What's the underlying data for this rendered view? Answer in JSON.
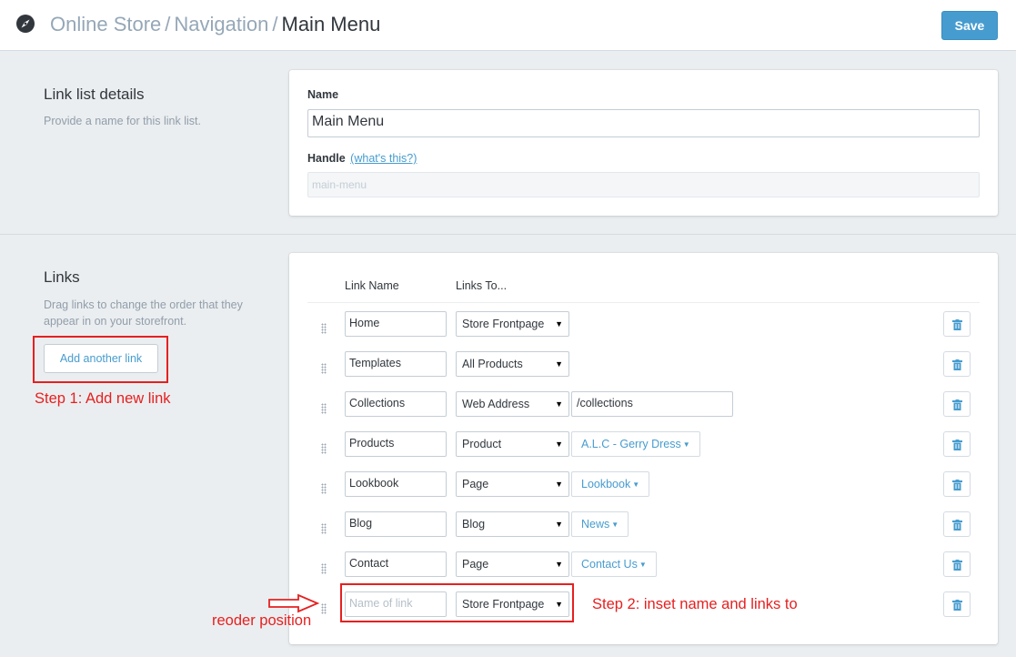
{
  "header": {
    "breadcrumb": [
      "Online Store",
      "Navigation"
    ],
    "current": "Main Menu",
    "separator": "/",
    "save_label": "Save"
  },
  "details": {
    "title": "Link list details",
    "description": "Provide a name for this link list.",
    "name_label": "Name",
    "name_value": "Main Menu",
    "handle_label": "Handle",
    "handle_help": "(what's this?)",
    "handle_value": "main-menu"
  },
  "links_section": {
    "title": "Links",
    "description": "Drag links to change the order that they appear in on your storefront.",
    "add_label": "Add another link",
    "col_name": "Link Name",
    "col_to": "Links To...",
    "rows": [
      {
        "name": "Home",
        "type": "Store Frontpage",
        "target": ""
      },
      {
        "name": "Templates",
        "type": "All Products",
        "target": ""
      },
      {
        "name": "Collections",
        "type": "Web Address",
        "target": "/collections"
      },
      {
        "name": "Products",
        "type": "Product",
        "target": "A.L.C - Gerry Dress"
      },
      {
        "name": "Lookbook",
        "type": "Page",
        "target": "Lookbook"
      },
      {
        "name": "Blog",
        "type": "Blog",
        "target": "News"
      },
      {
        "name": "Contact",
        "type": "Page",
        "target": "Contact Us"
      }
    ],
    "new_row": {
      "placeholder": "Name of link",
      "type": "Store Frontpage"
    }
  },
  "annotations": {
    "step1": "Step 1: Add new link",
    "step2": "Step 2: inset name and links to",
    "reorder": "reoder position",
    "color": "#e62020"
  }
}
